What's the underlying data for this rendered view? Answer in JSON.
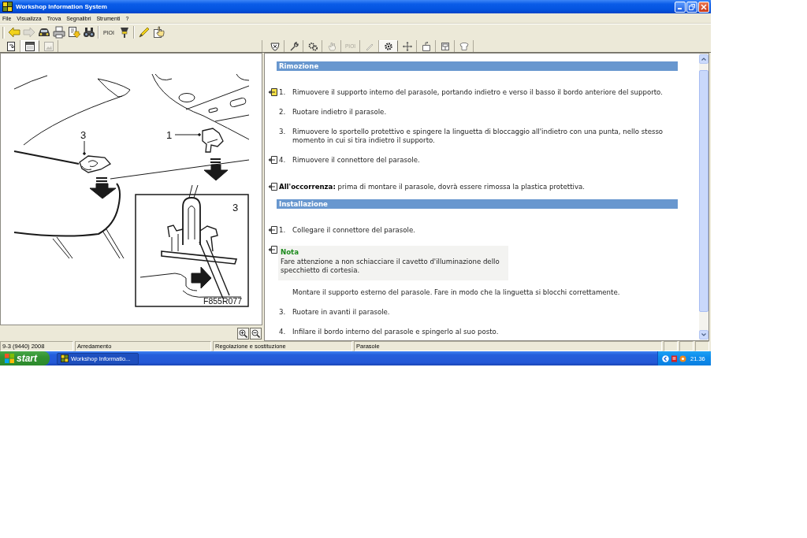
{
  "window": {
    "title": "Workshop Information System"
  },
  "menu": [
    "File",
    "Visualizza",
    "Trova",
    "Segnalibri",
    "Strumenti",
    "?"
  ],
  "toolbar": [
    {
      "buttons": [
        {
          "disabled": false
        },
        {
          "disabled": true
        },
        {
          "disabled": false
        },
        {
          "disabled": false
        },
        {
          "disabled": false
        },
        {
          "disabled": false
        }
      ]
    },
    {
      "buttons": [
        {
          "label": "PIOI",
          "disabled": false
        },
        {
          "disabled": false
        }
      ]
    },
    {
      "buttons": [
        {
          "disabled": false
        },
        {
          "disabled": false
        }
      ]
    }
  ],
  "left_panel": {
    "tabs": [
      {
        "selected": false,
        "disabled": false
      },
      {
        "selected": true,
        "disabled": false
      },
      {
        "selected": false,
        "disabled": true
      }
    ],
    "illustration": {
      "callouts": [
        "3",
        "1"
      ],
      "inset_label": "3",
      "figure_code": "F855R077"
    }
  },
  "right_panel": {
    "tabs": [
      {
        "selected": false,
        "disabled": false
      },
      {
        "selected": false,
        "disabled": false
      },
      {
        "selected": false,
        "disabled": false
      },
      {
        "selected": false,
        "disabled": true
      },
      {
        "label": "PIOI",
        "selected": false,
        "disabled": true
      },
      {
        "selected": false,
        "disabled": true
      },
      {
        "selected": true,
        "disabled": false
      },
      {
        "selected": false,
        "disabled": false
      },
      {
        "selected": false,
        "disabled": false
      },
      {
        "selected": false,
        "disabled": false
      },
      {
        "selected": false,
        "disabled": false
      }
    ],
    "content": [
      {
        "kind": "heading",
        "text": "Rimozione"
      },
      {
        "kind": "step",
        "number": "1.",
        "text": "Rimuovere il supporto interno del parasole, portando indietro e verso il basso il bordo anteriore del supporto.",
        "marker": true,
        "highlighted": true
      },
      {
        "kind": "step",
        "number": "2.",
        "text": "Ruotare indietro il parasole.",
        "marker": false
      },
      {
        "kind": "step",
        "number": "3.",
        "text": "Rimuovere lo sportello protettivo e spingere la linguetta di bloccaggio all'indietro con una punta, nello stesso momento in cui si tira indietro il supporto.",
        "marker": false
      },
      {
        "kind": "step",
        "number": "4.",
        "text": "Rimuovere il connettore del parasole.",
        "marker": true,
        "highlighted": false
      },
      {
        "kind": "remark",
        "text": "**All'occorrenza:** prima di montare il parasole, dovrà essere rimossa la plastica protettiva.",
        "marker": true,
        "highlighted": false
      },
      {
        "kind": "heading",
        "text": "Installazione"
      },
      {
        "kind": "step",
        "number": "1.",
        "text": "Collegare il connettore del parasole.",
        "marker": true,
        "highlighted": false
      },
      {
        "kind": "note",
        "title": "Nota",
        "text": "Fare attenzione a non schiacciare il cavetto d'illuminazione dello specchietto di cortesia.",
        "marker": true,
        "highlighted": false
      },
      {
        "kind": "step",
        "text": "Montare il supporto esterno del parasole. Fare in modo che la linguetta si blocchi correttamente.",
        "marker": false
      },
      {
        "kind": "step",
        "number": "3.",
        "text": "Ruotare in avanti il parasole.",
        "marker": false
      },
      {
        "kind": "step",
        "number": "4.",
        "text": "Infilare il bordo interno del parasole e spingerlo al suo posto.",
        "marker": false
      }
    ]
  },
  "status_bar": [
    "9-3 (9440) 2008",
    "Arredamento",
    "Regolazione e sostituzione",
    "Parasole"
  ],
  "taskbar": {
    "start": "start",
    "tasks": [
      {
        "label": "Workshop Informatio...",
        "selected": true
      }
    ],
    "clock": "21.36"
  }
}
